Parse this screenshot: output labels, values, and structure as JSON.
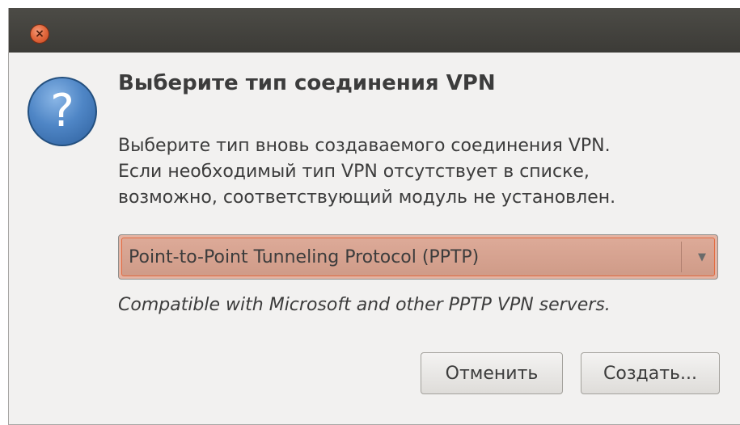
{
  "window": {
    "close_glyph": "×"
  },
  "dialog": {
    "icon": "question-icon",
    "icon_glyph": "?",
    "heading": "Выберите тип соединения VPN",
    "description_lines": [
      "Выберите тип вновь создаваемого соединения VPN.",
      "Если необходимый тип VPN отсутствует в списке,",
      "возможно, соответствующий модуль не установлен."
    ],
    "combo": {
      "selected": "Point-to-Point Tunneling Protocol (PPTP)",
      "arrow_glyph": "▼"
    },
    "type_description": "Compatible with Microsoft and other PPTP VPN servers.",
    "buttons": {
      "cancel": "Отменить",
      "create": "Создать..."
    }
  },
  "colors": {
    "titlebar": "#3c3b37",
    "close_button": "#e36b40",
    "dialog_bg": "#f2f1f0",
    "combo_bg": "#cf9b88",
    "icon_blue": "#4f86c6"
  }
}
